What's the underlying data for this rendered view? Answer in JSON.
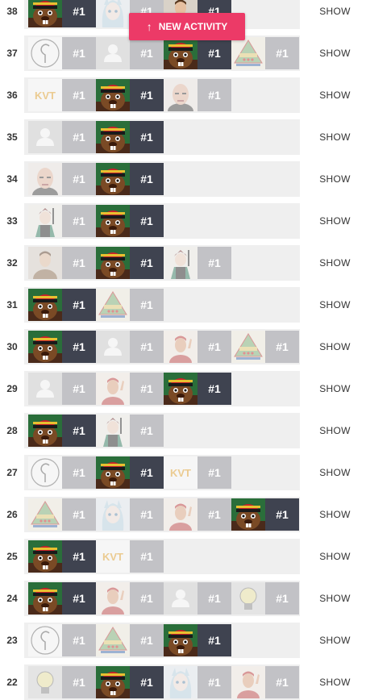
{
  "new_activity": {
    "arrow": "↑",
    "label": "NEW ACTIVITY"
  },
  "show_label": "SHOW",
  "rows": [
    {
      "num": "38",
      "entries": [
        {
          "avatar": "beaver",
          "rank": "#1",
          "state": "dark"
        },
        {
          "avatar": "anime-girl",
          "rank": "#1",
          "state": "light"
        },
        {
          "avatar": "person",
          "rank": "#1",
          "state": "dark"
        }
      ]
    },
    {
      "num": "37",
      "entries": [
        {
          "avatar": "swirl",
          "rank": "#1",
          "state": "light"
        },
        {
          "avatar": "placeholder",
          "rank": "#1",
          "state": "light"
        },
        {
          "avatar": "beaver",
          "rank": "#1",
          "state": "dark"
        },
        {
          "avatar": "pyramid",
          "rank": "#1",
          "state": "light"
        }
      ]
    },
    {
      "num": "36",
      "entries": [
        {
          "avatar": "kvt",
          "rank": "#1",
          "state": "light"
        },
        {
          "avatar": "beaver",
          "rank": "#1",
          "state": "dark"
        },
        {
          "avatar": "bald-man",
          "rank": "#1",
          "state": "light"
        }
      ]
    },
    {
      "num": "35",
      "entries": [
        {
          "avatar": "placeholder",
          "rank": "#1",
          "state": "light"
        },
        {
          "avatar": "beaver",
          "rank": "#1",
          "state": "dark"
        }
      ]
    },
    {
      "num": "34",
      "entries": [
        {
          "avatar": "bald-man",
          "rank": "#1",
          "state": "light"
        },
        {
          "avatar": "beaver",
          "rank": "#1",
          "state": "dark"
        }
      ]
    },
    {
      "num": "33",
      "entries": [
        {
          "avatar": "anime-boy",
          "rank": "#1",
          "state": "light"
        },
        {
          "avatar": "beaver",
          "rank": "#1",
          "state": "dark"
        }
      ]
    },
    {
      "num": "32",
      "entries": [
        {
          "avatar": "person",
          "rank": "#1",
          "state": "light"
        },
        {
          "avatar": "beaver",
          "rank": "#1",
          "state": "dark"
        },
        {
          "avatar": "anime-boy",
          "rank": "#1",
          "state": "light"
        }
      ]
    },
    {
      "num": "31",
      "entries": [
        {
          "avatar": "beaver",
          "rank": "#1",
          "state": "dark"
        },
        {
          "avatar": "pyramid",
          "rank": "#1",
          "state": "light"
        }
      ]
    },
    {
      "num": "30",
      "entries": [
        {
          "avatar": "beaver",
          "rank": "#1",
          "state": "dark"
        },
        {
          "avatar": "placeholder",
          "rank": "#1",
          "state": "light"
        },
        {
          "avatar": "peace-man",
          "rank": "#1",
          "state": "light"
        },
        {
          "avatar": "pyramid",
          "rank": "#1",
          "state": "light"
        }
      ]
    },
    {
      "num": "29",
      "entries": [
        {
          "avatar": "placeholder",
          "rank": "#1",
          "state": "light"
        },
        {
          "avatar": "peace-man",
          "rank": "#1",
          "state": "light"
        },
        {
          "avatar": "beaver",
          "rank": "#1",
          "state": "dark"
        }
      ]
    },
    {
      "num": "28",
      "entries": [
        {
          "avatar": "beaver",
          "rank": "#1",
          "state": "dark"
        },
        {
          "avatar": "anime-boy",
          "rank": "#1",
          "state": "light"
        }
      ]
    },
    {
      "num": "27",
      "entries": [
        {
          "avatar": "swirl",
          "rank": "#1",
          "state": "light"
        },
        {
          "avatar": "beaver",
          "rank": "#1",
          "state": "dark"
        },
        {
          "avatar": "kvt",
          "rank": "#1",
          "state": "light"
        }
      ]
    },
    {
      "num": "26",
      "entries": [
        {
          "avatar": "pyramid",
          "rank": "#1",
          "state": "light"
        },
        {
          "avatar": "anime-girl",
          "rank": "#1",
          "state": "light"
        },
        {
          "avatar": "peace-man",
          "rank": "#1",
          "state": "light"
        },
        {
          "avatar": "beaver",
          "rank": "#1",
          "state": "dark"
        }
      ]
    },
    {
      "num": "25",
      "entries": [
        {
          "avatar": "beaver",
          "rank": "#1",
          "state": "dark"
        },
        {
          "avatar": "kvt",
          "rank": "#1",
          "state": "light"
        }
      ]
    },
    {
      "num": "24",
      "entries": [
        {
          "avatar": "beaver",
          "rank": "#1",
          "state": "dark"
        },
        {
          "avatar": "peace-man",
          "rank": "#1",
          "state": "light"
        },
        {
          "avatar": "placeholder",
          "rank": "#1",
          "state": "light"
        },
        {
          "avatar": "bulb",
          "rank": "#1",
          "state": "light"
        }
      ]
    },
    {
      "num": "23",
      "entries": [
        {
          "avatar": "swirl",
          "rank": "#1",
          "state": "light"
        },
        {
          "avatar": "pyramid",
          "rank": "#1",
          "state": "light"
        },
        {
          "avatar": "beaver",
          "rank": "#1",
          "state": "dark"
        }
      ]
    },
    {
      "num": "22",
      "entries": [
        {
          "avatar": "bulb",
          "rank": "#1",
          "state": "light"
        },
        {
          "avatar": "beaver",
          "rank": "#1",
          "state": "dark"
        },
        {
          "avatar": "anime-girl",
          "rank": "#1",
          "state": "light"
        },
        {
          "avatar": "peace-man",
          "rank": "#1",
          "state": "light"
        }
      ]
    }
  ]
}
